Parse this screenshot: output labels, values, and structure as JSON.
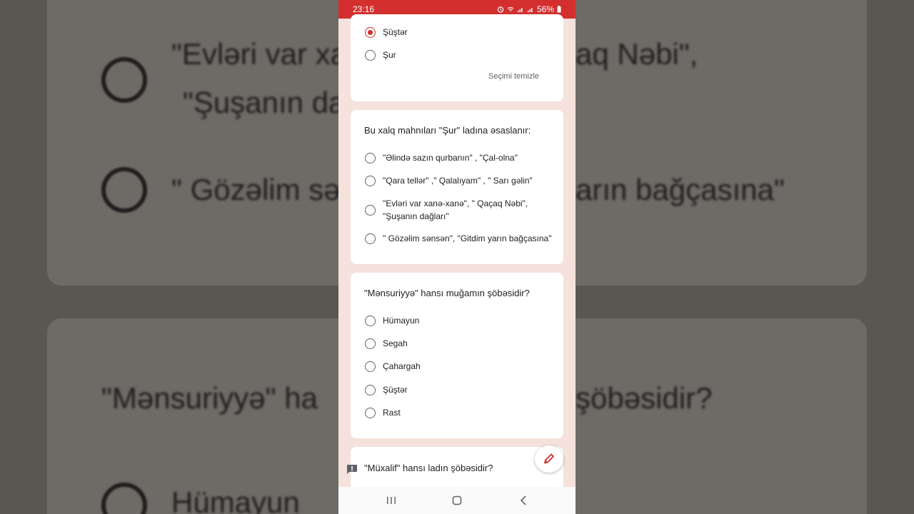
{
  "status_bar": {
    "time": "23:16",
    "battery": "56%"
  },
  "card1": {
    "options": [
      {
        "label": "Şüştər",
        "selected": true
      },
      {
        "label": "Şur",
        "selected": false
      }
    ],
    "clear_label": "Seçimi temizle"
  },
  "card2": {
    "question": "Bu xalq mahnıları \"Şur\" ladına əsaslanır:",
    "options": [
      {
        "label": "\"Əlində sazın qurbanın\" , \"Çal-olna\""
      },
      {
        "label": "\"Qara tellər\" ,\" Qalalıyam\" , \" Sarı gəlin\""
      },
      {
        "label_line1": "\"Evləri var xanə-xanə\", \" Qaçaq Nəbi\",",
        "label_line2": "\"Şuşanın dağları\""
      },
      {
        "label": "\" Gözəlim sənsən\", \"Gitdim yarın bağçasına\""
      }
    ]
  },
  "card3": {
    "question": "\"Mənsuriyyə\" hansı muğamın şöbəsidir?",
    "options": [
      {
        "label": "Hümayun"
      },
      {
        "label": "Segah"
      },
      {
        "label": "Çahargah"
      },
      {
        "label": "Şüştər"
      },
      {
        "label": "Rast"
      }
    ]
  },
  "card4": {
    "question": "\"Müxalif\" hansı ladın şöbəsidir?"
  },
  "background": {
    "line1": "\"Evləri var xa",
    "line1b": "aq Nəbi\",",
    "line2": "\"Şuşanın da",
    "line3": "\" Gözəlim sə",
    "line3b": "arın bağçasına\"",
    "line4": "\"Mənsuriyyə\" ha",
    "line4b": "şöbəsidir?",
    "line5": "Hümayun"
  },
  "colors": {
    "accent": "#d32f2f",
    "page_bg": "#f5e2dd"
  },
  "icons": {
    "fab": "pencil-icon",
    "feedback": "report-icon"
  }
}
